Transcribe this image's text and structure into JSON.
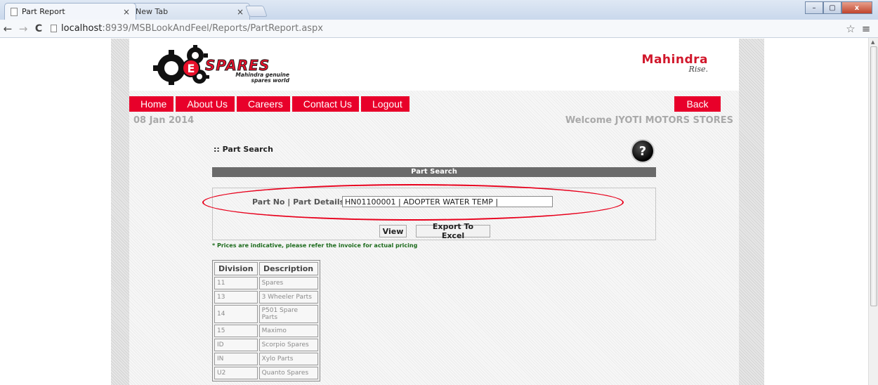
{
  "browser": {
    "tabs": [
      {
        "title": "Part Report",
        "active": true
      },
      {
        "title": "New Tab",
        "active": false
      }
    ],
    "url_host": "localhost",
    "url_rest": ":8939/MSBLookAndFeel/Reports/PartReport.aspx",
    "icons": {
      "back": "←",
      "forward": "→",
      "reload": "C",
      "star": "☆",
      "menu": "≡",
      "close": "×",
      "minimize": "–",
      "maximize": "▢",
      "win_close": "x"
    }
  },
  "header": {
    "logo_text": "SPARES",
    "logo_letter": "E",
    "logo_tagline_line1": "Mahindra genuine",
    "logo_tagline_line2": "spares world",
    "brand_name": "Mahindra",
    "brand_tagline": "Rise."
  },
  "nav": {
    "items": [
      "Home",
      "About Us",
      "Careers",
      "Contact Us",
      "Logout"
    ],
    "back": "Back"
  },
  "info": {
    "date": "08 Jan 2014",
    "welcome": "Welcome JYOTI MOTORS STORES"
  },
  "search": {
    "section_title": ":: Part Search",
    "help_glyph": "?",
    "panel_title": "Part Search",
    "field_label": "Part No | Part Details",
    "field_value": "HN01100001 | ADOPTER WATER TEMP |",
    "view_button": "View",
    "export_button": "Export To Excel",
    "note": "* Prices are indicative, please refer the invoice for actual pricing"
  },
  "divisions": {
    "headers": [
      "Division",
      "Description"
    ],
    "rows": [
      [
        "11",
        "Spares"
      ],
      [
        "13",
        "3 Wheeler Parts"
      ],
      [
        "14",
        "P501 Spare Parts"
      ],
      [
        "15",
        "Maximo"
      ],
      [
        "ID",
        "Scorpio Spares"
      ],
      [
        "IN",
        "Xylo Parts"
      ],
      [
        "U2",
        "Quanto Spares"
      ]
    ]
  },
  "colors": {
    "nav_red": "#e8002a",
    "brand_red": "#d1172b",
    "highlight": "#e8001c",
    "note_green": "#1c6b1c"
  }
}
